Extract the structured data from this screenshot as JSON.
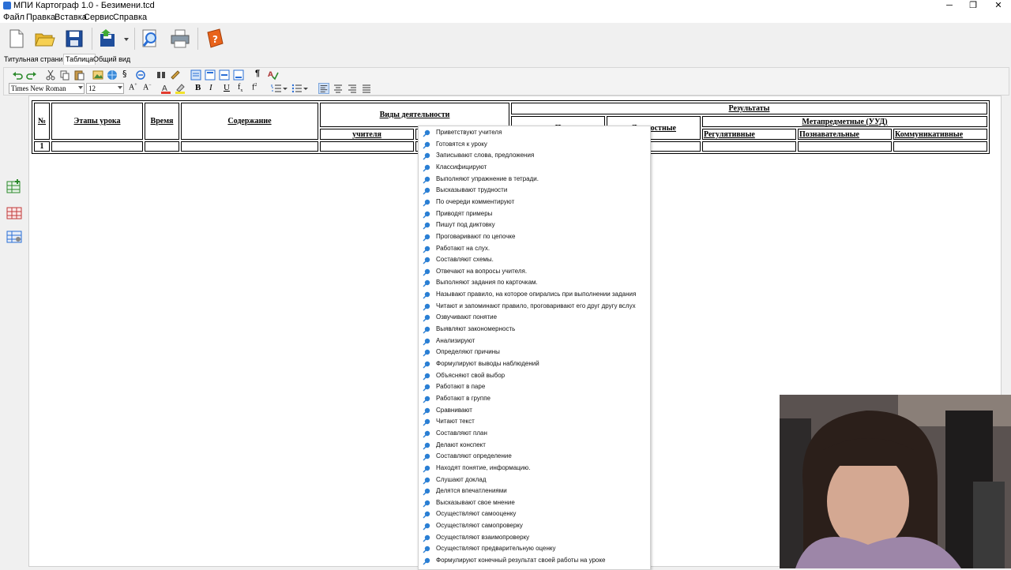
{
  "window": {
    "title": "МПИ Картограф 1.0 - Безимени.tcd",
    "minimize": "─",
    "restore": "❐",
    "close": "✕"
  },
  "menu": [
    "Файл",
    "Правка",
    "Вставка",
    "Сервис",
    "Справка"
  ],
  "tabs": [
    {
      "label": "Титульная страница",
      "active": false
    },
    {
      "label": "Таблица",
      "active": true
    },
    {
      "label": "Общий вид",
      "active": false
    }
  ],
  "format": {
    "font_name": "Times New Roman",
    "font_size": "12"
  },
  "table": {
    "num_header": "№",
    "stages_header": "Этапы урока",
    "time_header": "Время",
    "content_header": "Содержание",
    "activities_header": "Виды деятельности",
    "teacher_header": "учителя",
    "results_header": "Результаты",
    "metasubject_header": "Метапредметные (УУД)",
    "subject_header_partial": "П",
    "personal_header_partial": "Личностные",
    "regulatory_header": "Регулятивные",
    "cognitive_header": "Познавательные",
    "communicative_header": "Коммуникативные",
    "row1_num": "1"
  },
  "popup_items": [
    "Приветствуют учителя",
    "Готовятся к уроку",
    "Записывают слова, предложения",
    "Классифицируют",
    "Выполняют упражнение в тетради.",
    "Высказывают трудности",
    "По очереди комментируют",
    "Приводят примеры",
    "Пишут под диктовку",
    "Проговаривают по цепочке",
    "Работают на слух.",
    "Составляют схемы.",
    "Отвечают на вопросы учителя.",
    "Выполняют задания по карточкам.",
    "Называют правило, на которое опирались при выполнении задания",
    "Читают и запоминают правило, проговаривают его друг другу вслух",
    "Озвучивают понятие",
    "Выявляют закономерность",
    "Анализируют",
    "Определяют причины",
    "Формулируют выводы наблюдений",
    "Объясняют свой выбор",
    "Работают в паре",
    "Работают в группе",
    "Сравнивают",
    "Читают текст",
    "Составляют план",
    "Делают конспект",
    "Составляют определение",
    "Находят понятие, информацию.",
    "Слушают доклад",
    "Делятся впечатлениями",
    "Высказывают свое мнение",
    "Осуществляют самооценку",
    "Осуществляют самопроверку",
    "Осуществляют взаимопроверку",
    "Осуществляют предварительную оценку",
    "Формулируют конечный результат своей работы на уроке"
  ],
  "colors": {
    "accent": "#2a7fd4",
    "item_icon": "#2a7fd4",
    "toolbar_bg": "#f0f0f0"
  }
}
